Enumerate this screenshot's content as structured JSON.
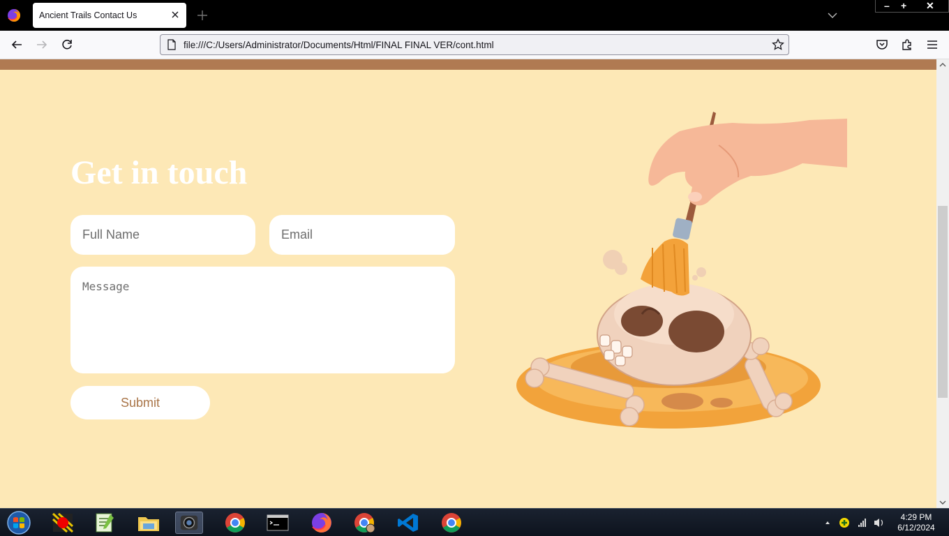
{
  "browser": {
    "tab_title": "Ancient Trails Contact Us",
    "url": "file:///C:/Users/Administrator/Documents/Html/FINAL FINAL VER/cont.html"
  },
  "page": {
    "heading": "Get in touch",
    "name_placeholder": "Full Name",
    "email_placeholder": "Email",
    "message_placeholder": "Message",
    "submit_label": "Submit"
  },
  "taskbar": {
    "time": "4:29 PM",
    "date": "6/12/2024",
    "apps": [
      "screen-recorder-icon",
      "notepad-plus-plus-icon",
      "file-explorer-icon",
      "camera-app-icon",
      "chrome-icon",
      "command-prompt-icon",
      "firefox-icon",
      "chrome-profile-icon",
      "vscode-icon",
      "chrome-icon"
    ]
  },
  "colors": {
    "page_background": "#fde8b6",
    "accent_brown": "#b07a52",
    "submit_text": "#a97548"
  }
}
